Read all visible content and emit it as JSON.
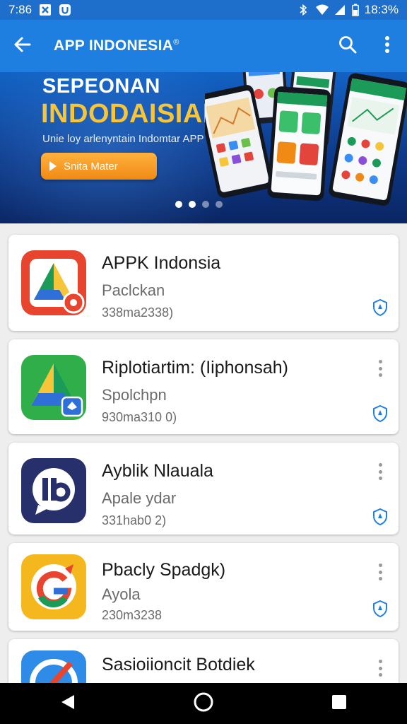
{
  "status_bar": {
    "time": "7:86",
    "battery": "18:3%",
    "icons": [
      "notification-x-icon",
      "notification-app-icon",
      "bluetooth-icon",
      "wifi-icon",
      "signal-icon",
      "battery-icon"
    ]
  },
  "app_bar": {
    "title": "APP INDONESIA",
    "title_mark": "®",
    "icons": [
      "back-arrow-icon",
      "search-icon",
      "more-vert-icon"
    ]
  },
  "banner": {
    "line1": "SEPEONAN",
    "line2": "INDODAISIAI",
    "line3": "Unie loy arlenyntain Indomtar APP",
    "cta_label": "Snita Mater",
    "dots_total": 4,
    "dot_active": 1,
    "colors": {
      "headline": "#f6c53a",
      "cta": "#f59a1f"
    }
  },
  "apps": [
    {
      "name": "APPK Indonsia",
      "category": "Paclckan",
      "meta": "338ma2338)",
      "icon": "app-red-icon",
      "has_more": false
    },
    {
      "name": "Riplotiartim: (Iiphonsah)",
      "category": "Spolchpn",
      "meta": "930ma310 0)",
      "icon": "app-green-icon",
      "has_more": true
    },
    {
      "name": "Ayblik Nlauala",
      "category": "Apale ydar",
      "meta": "331hab0 2)",
      "icon": "app-navy-icon",
      "has_more": true
    },
    {
      "name": "Pbacly Spadgk)",
      "category": "Ayola",
      "meta": "230m3238",
      "icon": "app-yellow-icon",
      "has_more": true
    },
    {
      "name": "Sasioiioncit Botdiek",
      "category": "",
      "meta": "",
      "icon": "app-blue-icon",
      "has_more": true
    }
  ],
  "nav_bar": {
    "icons": [
      "nav-back-icon",
      "nav-home-icon",
      "nav-recents-icon"
    ]
  }
}
